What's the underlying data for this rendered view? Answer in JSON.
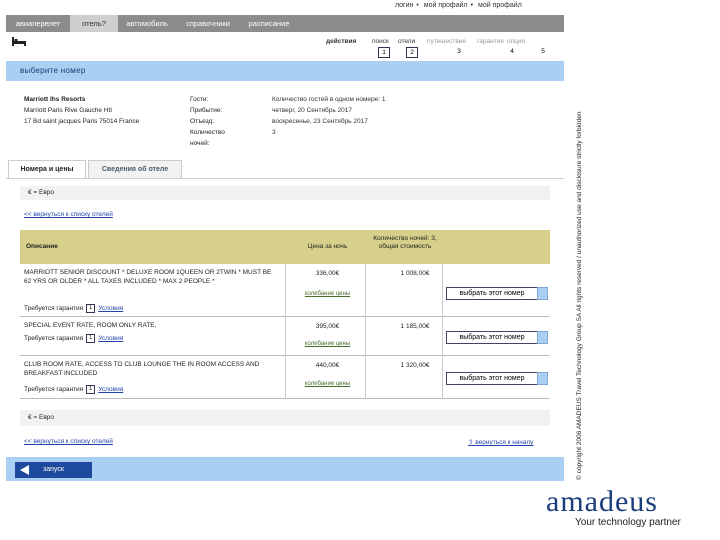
{
  "top_links": [
    "логин",
    "мой профайл",
    "мой профайл"
  ],
  "nav": {
    "tabs": [
      "авиаперелет",
      "отель?",
      "автомобиль",
      "справочники",
      "расписание"
    ],
    "active_index": 1
  },
  "steps": {
    "labels": [
      "действия",
      "поиск",
      "отели",
      "путешествие",
      "гарантия",
      "опция"
    ],
    "numbers": [
      "1",
      "2",
      "3",
      "4",
      "5"
    ]
  },
  "title": "выберите номер",
  "hotel": {
    "name": "Marriott Ihs Resorts",
    "address1": "Marriott Paris Rive Gauche Htl",
    "address2": "17 Bd saint jacques Paris 75014 France"
  },
  "booking_details": [
    {
      "label": "Гости:",
      "value": "Количество гостей в одном номере: 1"
    },
    {
      "label": "Прибытие:",
      "value": "четверг, 20 Сентябрь 2017"
    },
    {
      "label": "Отъезд:",
      "value": "воскресенье, 23 Сентябрь 2017"
    },
    {
      "label": "Количество ночей:",
      "value": "3"
    }
  ],
  "tabs": [
    "Номера и цены",
    "Сведения об отеле"
  ],
  "currency": "€ = Евро",
  "back_to_list": "<< вернуться к списку отелей",
  "table": {
    "headers": [
      "Описание",
      "Цена за ночь",
      "Количество ночей: 3, общая стоимость"
    ],
    "rows": [
      {
        "description": "MARRIOTT SENIOR DISCOUNT * DELUXE ROOM 1QUEEN OR 2TWIN * MUST BE 62 YRS OR OLDER * ALL TAXES INCLUDED * MAX 2 PEOPLE *",
        "price": "336,00€",
        "total": "1 008,00€",
        "details_link": "колебание цены",
        "guarantee_label": "Требуется гарантия",
        "guarantee_box": "1",
        "conditions": "Условия",
        "button": "выбрать этот номер"
      },
      {
        "description": "SPECIAL EVENT RATE, ROOM ONLY RATE,",
        "price": "395,00€",
        "total": "1 185,00€",
        "details_link": "колебание цены",
        "guarantee_label": "Требуется гарантия",
        "guarantee_box": "1",
        "conditions": "Условия",
        "button": "выбрать этот номер"
      },
      {
        "description": "CLUB ROOM RATE, ACCESS TO CLUB LOUNGE THE IN ROOM ACCESS AND BREAKFAST INCLUDED",
        "price": "440,00€",
        "total": "1 320,00€",
        "details_link": "колебание цены",
        "guarantee_label": "Требуется гарантия",
        "guarantee_box": "1",
        "conditions": "Условия",
        "button": "выбрать этот номер"
      }
    ]
  },
  "currency_bottom": "€ = Евро",
  "back_to_list_bottom": "<< вернуться к списку отелей",
  "back_to_top": "вернуться к началу",
  "launch_button": "запуск",
  "copyright": "© copyright 2006 AMADEUS Travel Technology Group SA All rights reserved / unauthorized use and disclosure strictly forbidden",
  "logo": "amadeus",
  "tagline": "Your technology partner",
  "colors": {
    "nav_bg": "#8c8c8c",
    "title_bg": "#a9d0f2",
    "header_bg": "#d6d08a",
    "logo": "#1a3c7a",
    "launch_bg": "#1d4a9c"
  }
}
